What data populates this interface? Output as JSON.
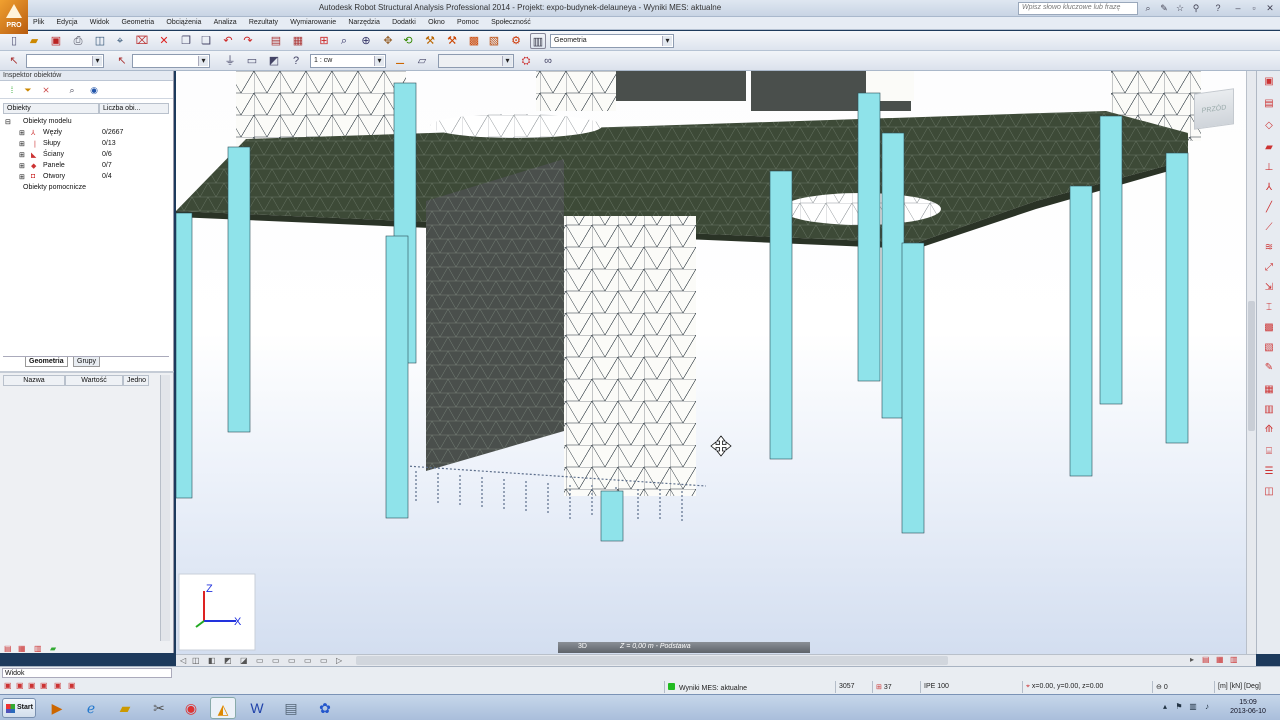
{
  "app": {
    "logo_text": "PRO",
    "window_title": "Autodesk Robot Structural Analysis Professional 2014 - Projekt: expo-budynek-delauneya - Wyniki MES: aktualne",
    "help_search_placeholder": "Wpisz słowo kluczowe lub frazę"
  },
  "menu": [
    "Plik",
    "Edycja",
    "Widok",
    "Geometria",
    "Obciążenia",
    "Analiza",
    "Rezultaty",
    "Wymiarowanie",
    "Narzędzia",
    "Dodatki",
    "Okno",
    "Pomoc",
    "Społeczność"
  ],
  "toolbar": {
    "layout_combo": "Geometria",
    "scale_combo": "1 : cw"
  },
  "inspector": {
    "title": "Inspektor obiektów",
    "columns": [
      "Obiekty",
      "Liczba obi..."
    ],
    "root": "Obiekty modelu",
    "items": [
      {
        "label": "Węzły",
        "count": "0/2667",
        "icon": "node-icon"
      },
      {
        "label": "Słupy",
        "count": "0/13",
        "icon": "column-icon"
      },
      {
        "label": "Ściany",
        "count": "0/6",
        "icon": "wall-icon"
      },
      {
        "label": "Panele",
        "count": "0/7",
        "icon": "panel-icon"
      },
      {
        "label": "Otwory",
        "count": "0/4",
        "icon": "opening-icon"
      }
    ],
    "aux": "Obiekty pomocnicze",
    "tabs": [
      "Geometria",
      "Grupy"
    ]
  },
  "properties": {
    "columns": [
      "Nazwa",
      "Wartość",
      "Jedno"
    ]
  },
  "viewport": {
    "view_cube_label": "PRZÓD",
    "view_mode": "3D",
    "level_label": "Z = 0,00 m - Podstawa",
    "axis_x": "X",
    "axis_z": "Z",
    "colors": {
      "slab": "#3d4a37",
      "column": "#8fe3ea",
      "mesh_line": "#1e2a33",
      "wall": "#4a4f4c"
    }
  },
  "status": {
    "left_panel_label": "Widok",
    "fem_status": "Wyniki MES: aktualne",
    "node_count": "3057",
    "bar_count": "37",
    "section": "IPE 100",
    "coords": "x=0.00, y=0.00, z=0.00",
    "angle": "0",
    "units": "[m] [kN] [Deg]"
  },
  "taskbar": {
    "start_label": "Start",
    "time": "15:09",
    "date": "2013-06-10"
  }
}
